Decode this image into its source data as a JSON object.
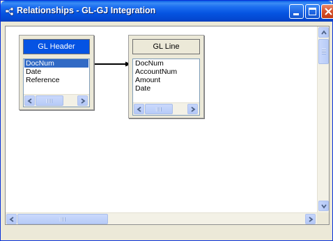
{
  "window": {
    "title": "Relationships - GL-GJ Integration",
    "controls": {
      "minimize": "minimize-icon",
      "maximize": "maximize-icon",
      "close": "close-icon"
    }
  },
  "tables": [
    {
      "name": "GL Header",
      "selected": true,
      "fields": [
        "DocNum",
        "Date",
        "Reference"
      ],
      "selected_field": "DocNum"
    },
    {
      "name": "GL Line",
      "selected": false,
      "fields": [
        "DocNum",
        "AccountNum",
        "Amount",
        "Date"
      ]
    }
  ],
  "relationship": {
    "from": "GL Header.DocNum",
    "to": "GL Line.DocNum"
  },
  "colors": {
    "title_bar": "#0554e1",
    "selection": "#316ac5",
    "selected_header": "#0553e3"
  }
}
